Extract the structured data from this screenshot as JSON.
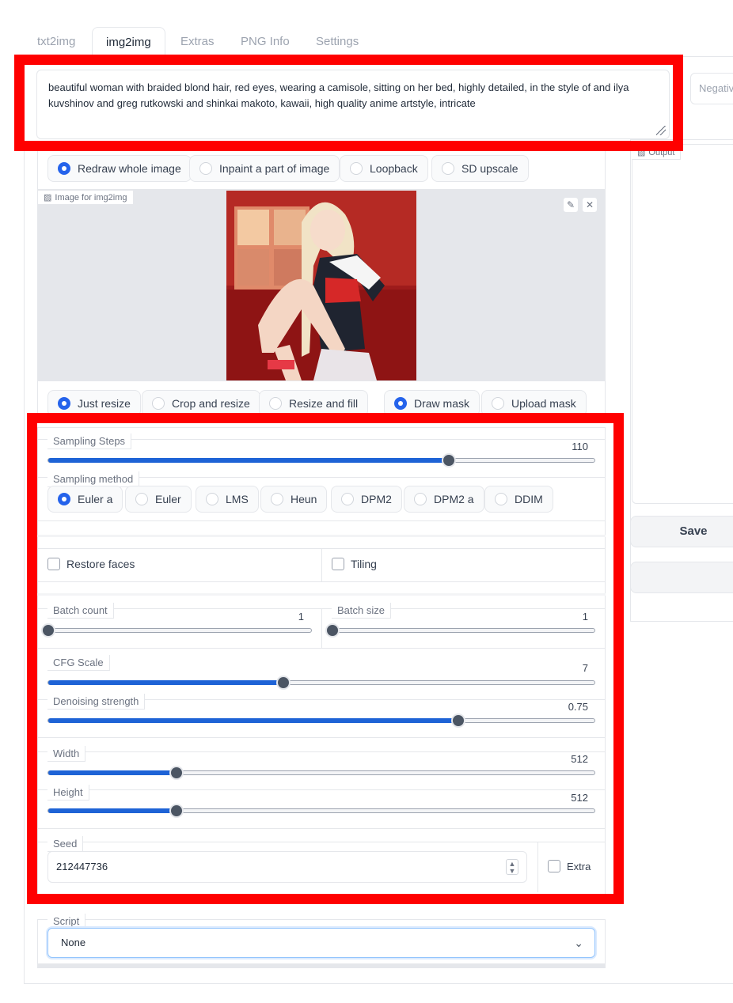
{
  "tabs": [
    "txt2img",
    "img2img",
    "Extras",
    "PNG Info",
    "Settings"
  ],
  "active_tab": "img2img",
  "prompt": "beautiful woman with braided blond hair, red eyes, wearing a camisole, sitting on her bed, highly detailed, in the style of and ilya kuvshinov and greg rutkowski and shinkai makoto, kawaii, high quality anime artstyle, intricate",
  "negative_prompt_placeholder": "Negative",
  "mode_options": [
    "Redraw whole image",
    "Inpaint a part of image",
    "Loopback",
    "SD upscale"
  ],
  "mode_selected": "Redraw whole image",
  "image_label": "Image for img2img",
  "output_label": "Output",
  "resize_options": [
    "Just resize",
    "Crop and resize",
    "Resize and fill"
  ],
  "resize_selected": "Just resize",
  "mask_options": [
    "Draw mask",
    "Upload mask"
  ],
  "mask_selected": "Draw mask",
  "sampling_steps": {
    "label": "Sampling Steps",
    "value": "110",
    "fraction": 0.733
  },
  "sampling_method": {
    "label": "Sampling method",
    "options": [
      "Euler a",
      "Euler",
      "LMS",
      "Heun",
      "DPM2",
      "DPM2 a",
      "DDIM"
    ],
    "selected": "Euler a"
  },
  "restore_faces": {
    "label": "Restore faces",
    "checked": false
  },
  "tiling": {
    "label": "Tiling",
    "checked": false
  },
  "batch_count": {
    "label": "Batch count",
    "value": "1",
    "fraction": 0.0
  },
  "batch_size": {
    "label": "Batch size",
    "value": "1",
    "fraction": 0.0
  },
  "cfg_scale": {
    "label": "CFG Scale",
    "value": "7",
    "fraction": 0.43
  },
  "denoising_strength": {
    "label": "Denoising strength",
    "value": "0.75",
    "fraction": 0.75
  },
  "width": {
    "label": "Width",
    "value": "512",
    "fraction": 0.235
  },
  "height": {
    "label": "Height",
    "value": "512",
    "fraction": 0.235
  },
  "seed": {
    "label": "Seed",
    "value": "212447736"
  },
  "extra": {
    "label": "Extra",
    "checked": false
  },
  "script": {
    "label": "Script",
    "value": "None"
  },
  "save_label": "Save",
  "colors": {
    "accent": "#2563eb",
    "slider_fill": "#1e63d6",
    "highlight": "#ff0000"
  }
}
